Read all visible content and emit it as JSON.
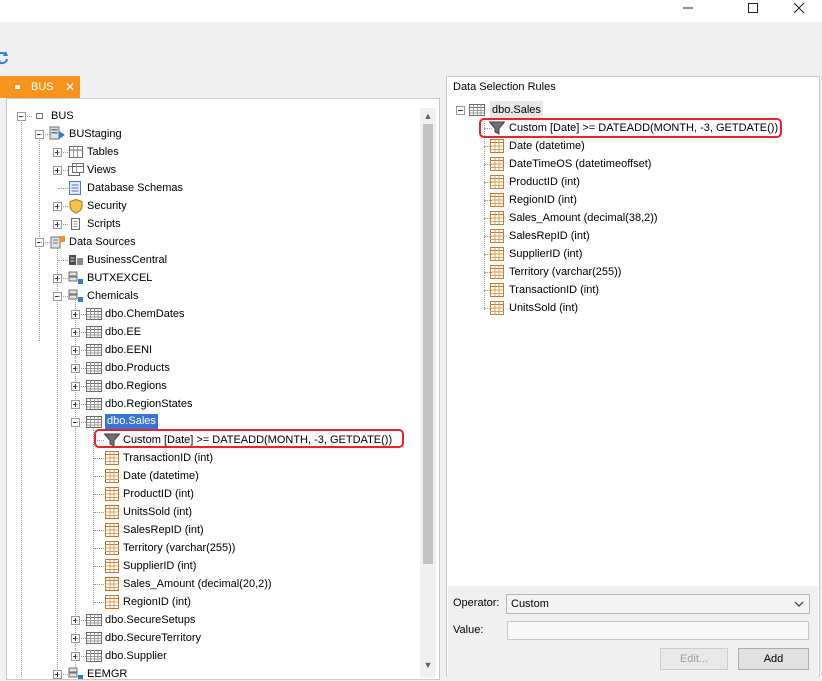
{
  "window": {
    "minimize_icon": "minimize-icon",
    "maximize_icon": "maximize-icon",
    "close_icon": "close-icon"
  },
  "toolbar": {
    "refresh_icon": "refresh-icon"
  },
  "tab": {
    "label": "BUS",
    "close": "✕"
  },
  "tree": {
    "root": "BUS",
    "staging": "BUStaging",
    "tables": "Tables",
    "views": "Views",
    "schemas": "Database Schemas",
    "security": "Security",
    "scripts": "Scripts",
    "data_sources": "Data Sources",
    "bc": "BusinessCentral",
    "butx": "BUTXEXCEL",
    "chemicals": "Chemicals",
    "chem_tables": [
      "dbo.ChemDates",
      "dbo.EE",
      "dbo.EENI",
      "dbo.Products",
      "dbo.Regions",
      "dbo.RegionStates"
    ],
    "sales": "dbo.Sales",
    "filter": "Custom [Date] >= DATEADD(MONTH, -3, GETDATE())",
    "sales_columns": [
      "TransactionID (int)",
      "Date (datetime)",
      "ProductID (int)",
      "UnitsSold (int)",
      "SalesRepID (int)",
      "Territory (varchar(255))",
      "SupplierID (int)",
      "Sales_Amount (decimal(20,2))",
      "RegionID (int)"
    ],
    "after_tables": [
      "dbo.SecureSetups",
      "dbo.SecureTerritory",
      "dbo.Supplier"
    ],
    "cut_off": "EEMGR"
  },
  "rules": {
    "title": "Data Selection Rules",
    "table": "dbo.Sales",
    "filter": "Custom [Date] >= DATEADD(MONTH, -3, GETDATE())",
    "columns": [
      "Date (datetime)",
      "DateTimeOS (datetimeoffset)",
      "ProductID (int)",
      "RegionID (int)",
      "Sales_Amount (decimal(38,2))",
      "SalesRepID (int)",
      "SupplierID (int)",
      "Territory (varchar(255))",
      "TransactionID (int)",
      "UnitsSold (int)"
    ]
  },
  "properties": {
    "operator_label": "Operator:",
    "operator_value": "Custom",
    "value_label": "Value:",
    "value": "",
    "edit_label": "Edit...",
    "add_label": "Add"
  },
  "colors": {
    "tab": "#f7941d",
    "selection": "#3875d7",
    "highlight": "#e8232a"
  }
}
